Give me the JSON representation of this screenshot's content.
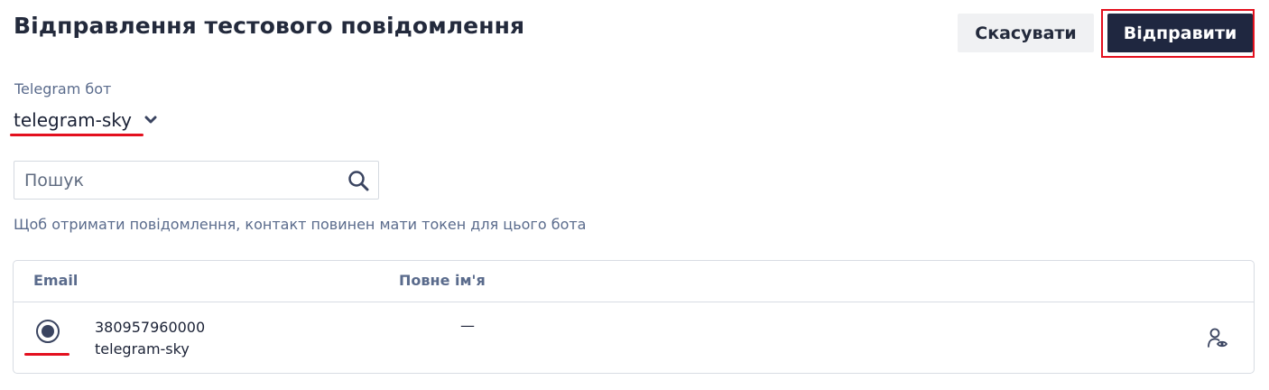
{
  "header": {
    "title": "Відправлення тестового повідомлення",
    "cancel_label": "Скасувати",
    "send_label": "Відправити"
  },
  "bot": {
    "label": "Telegram бот",
    "selected": "telegram-sky"
  },
  "search": {
    "placeholder": "Пошук",
    "value": ""
  },
  "hint": "Щоб отримати повідомлення, контакт повинен мати токен для цього бота",
  "table": {
    "columns": [
      "Email",
      "Повне ім'я"
    ],
    "rows": [
      {
        "selected": true,
        "primary": "380957960000",
        "secondary": "telegram-sky",
        "full_name": "—"
      }
    ]
  },
  "icons": {
    "bot_dropdown": "chevron-down-icon",
    "search": "search-icon",
    "view_contact": "user-view-icon"
  },
  "colors": {
    "primary_button": "#1f2740",
    "annotation_red": "#e3101e",
    "muted_text": "#5a6b8c"
  }
}
